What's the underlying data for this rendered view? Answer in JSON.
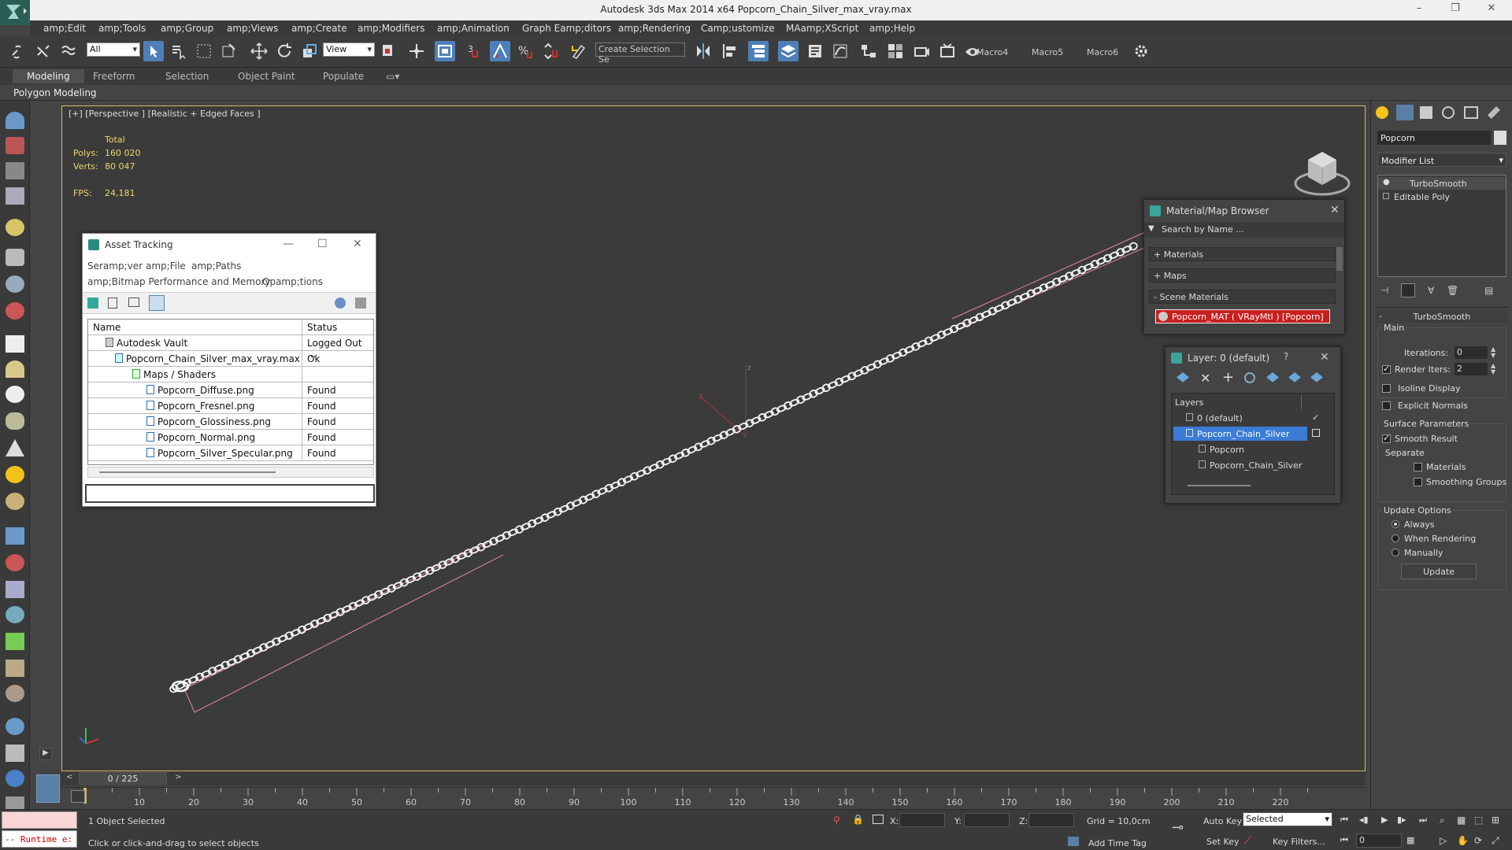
{
  "window": {
    "title": "Autodesk 3ds Max  2014 x64     Popcorn_Chain_Silver_max_vray.max"
  },
  "menu": [
    "amp;Edit",
    "amp;Tools",
    "amp;Group",
    "amp;Views",
    "amp;Create",
    "amp;Modifiers",
    "amp;Animation",
    "Graph Eamp;ditors",
    "amp;Rendering",
    "Camp;ustomize",
    "MAamp;XScript",
    "amp;Help"
  ],
  "toolbar": {
    "selection_filter": "All",
    "ref_coord": "View",
    "named_selection": "Create Selection Se",
    "macros": [
      "Macro4",
      "Macro5",
      "Macro6"
    ]
  },
  "ribbon": {
    "tabs": [
      "Modeling",
      "Freeform",
      "Selection",
      "Object Paint",
      "Populate"
    ],
    "active_panel": "Polygon Modeling"
  },
  "viewport": {
    "label": "[+] [Perspective ] [Realistic + Edged Faces ]",
    "stats": {
      "header": "Total",
      "polys_label": "Polys:",
      "polys": "160 020",
      "verts_label": "Verts:",
      "verts": "80 047",
      "fps_label": "FPS:",
      "fps": "24,181"
    },
    "axis_labels": {
      "z": "z",
      "y": "y"
    }
  },
  "asset_tracking": {
    "title": "Asset Tracking",
    "menu": [
      "Seramp;ver",
      "amp;File",
      "amp;Paths",
      "amp;Bitmap Performance and Memory",
      "Opamp;tions"
    ],
    "columns": [
      "Name",
      "Status"
    ],
    "rows": [
      {
        "name": "Autodesk Vault",
        "status": "Logged Out ..."
      },
      {
        "name": "Popcorn_Chain_Silver_max_vray.max",
        "status": "Ok"
      },
      {
        "name": "Maps / Shaders",
        "status": ""
      },
      {
        "name": "Popcorn_Diffuse.png",
        "status": "Found"
      },
      {
        "name": "Popcorn_Fresnel.png",
        "status": "Found"
      },
      {
        "name": "Popcorn_Glossiness.png",
        "status": "Found"
      },
      {
        "name": "Popcorn_Normal.png",
        "status": "Found"
      },
      {
        "name": "Popcorn_Silver_Specular.png",
        "status": "Found"
      }
    ]
  },
  "material_browser": {
    "title": "Material/Map Browser",
    "search_placeholder": "Search by Name ...",
    "sections": [
      "+ Materials",
      "+ Maps",
      "- Scene Materials"
    ],
    "scene_material": "Popcorn_MAT ( VRayMtl ) [Popcorn]"
  },
  "layer_dialog": {
    "title": "Layer: 0 (default)",
    "help": "?",
    "header": "Layers",
    "rows": [
      "0 (default)",
      "Popcorn_Chain_Silver",
      "Popcorn",
      "Popcorn_Chain_Silver"
    ]
  },
  "command_panel": {
    "object_name": "Popcorn",
    "modifier_list": "Modifier List",
    "stack": [
      "TurboSmooth",
      "Editable Poly"
    ],
    "rollout_title": "TurboSmooth",
    "main_group": "Main",
    "iterations_label": "Iterations:",
    "iterations": "0",
    "render_iters_label": "Render Iters:",
    "render_iters": "2",
    "render_iters_checked": true,
    "isoline": "Isoline Display",
    "explicit_normals": "Explicit Normals",
    "surface_params": "Surface Parameters",
    "smooth_result": "Smooth Result",
    "smooth_result_checked": true,
    "separate": "Separate",
    "materials": "Materials",
    "smoothing_groups": "Smoothing Groups",
    "update_options": "Update Options",
    "always": "Always",
    "when_rendering": "When Rendering",
    "manually": "Manually",
    "update_button": "Update"
  },
  "timeline": {
    "frame": "0 / 225",
    "ticks": [
      "10",
      "20",
      "30",
      "40",
      "50",
      "60",
      "70",
      "80",
      "90",
      "100",
      "110",
      "120",
      "130",
      "140",
      "150",
      "160",
      "170",
      "180",
      "190",
      "200",
      "210",
      "220"
    ]
  },
  "status": {
    "script_text": "-- Runtime e:",
    "objects_selected": "1 Object Selected",
    "prompt": "Click or click-and-drag to select objects",
    "x_label": "X:",
    "y_label": "Y:",
    "z_label": "Z:",
    "grid": "Grid = 10,0cm",
    "add_time_tag": "Add Time Tag",
    "auto_key": "Auto Key",
    "set_key": "Set Key",
    "key_mode": "Selected",
    "key_filters": "Key Filters...",
    "frame_field": "0"
  },
  "colors": {
    "accent": "#4f7fb8",
    "selection_highlight": "#3a7bd5",
    "stats_text": "#ecd96c",
    "material_swatch_red": "#c81f1f",
    "viewport_border": "#d6b86b"
  }
}
